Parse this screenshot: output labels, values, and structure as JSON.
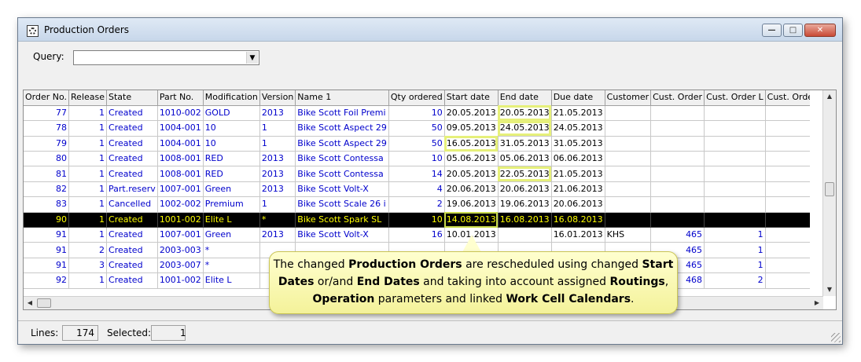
{
  "window": {
    "title": "Production Orders",
    "controls": [
      "minimize-icon",
      "maximize-icon",
      "close-icon"
    ]
  },
  "query": {
    "label": "Query:",
    "value": ""
  },
  "table": {
    "columns": [
      "Order No.",
      "Release",
      "State",
      "Part No.",
      "Modification",
      "Version",
      "Name 1",
      "Qty ordered",
      "Start date",
      "End date",
      "Due date",
      "Customer",
      "Cust. Order",
      "Cust. Order L",
      "Cust. Orde"
    ],
    "rows": [
      [
        "77",
        "1",
        "Created",
        "1010-002",
        "GOLD",
        "2013",
        "Bike Scott Foil Premi",
        "10",
        "20.05.2013",
        "20.05.2013",
        "21.05.2013",
        "",
        "",
        "",
        ""
      ],
      [
        "78",
        "1",
        "Created",
        "1004-001",
        "10",
        "1",
        "Bike Scott Aspect 29",
        "50",
        "09.05.2013",
        "24.05.2013",
        "24.05.2013",
        "",
        "",
        "",
        ""
      ],
      [
        "79",
        "1",
        "Created",
        "1004-001",
        "10",
        "1",
        "Bike Scott Aspect 29",
        "50",
        "16.05.2013",
        "31.05.2013",
        "31.05.2013",
        "",
        "",
        "",
        ""
      ],
      [
        "80",
        "1",
        "Created",
        "1008-001",
        "RED",
        "2013",
        "Bike Scott Contessa",
        "10",
        "05.06.2013",
        "05.06.2013",
        "06.06.2013",
        "",
        "",
        "",
        ""
      ],
      [
        "81",
        "1",
        "Created",
        "1008-001",
        "RED",
        "2013",
        "Bike Scott Contessa",
        "14",
        "20.05.2013",
        "22.05.2013",
        "21.05.2013",
        "",
        "",
        "",
        ""
      ],
      [
        "82",
        "1",
        "Part.reserv",
        "1007-001",
        "Green",
        "2013",
        "Bike Scott Volt-X",
        "4",
        "20.06.2013",
        "20.06.2013",
        "21.06.2013",
        "",
        "",
        "",
        ""
      ],
      [
        "83",
        "1",
        "Cancelled",
        "1002-002",
        "Premium",
        "1",
        "Bike Scott Scale 26 i",
        "2",
        "19.06.2013",
        "19.06.2013",
        "20.06.2013",
        "",
        "",
        "",
        ""
      ],
      [
        "90",
        "1",
        "Created",
        "1001-002",
        "Elite L",
        "*",
        "Bike Scott Spark SL",
        "10",
        "14.08.2013",
        "16.08.2013",
        "16.08.2013",
        "",
        "",
        "",
        ""
      ],
      [
        "91",
        "1",
        "Created",
        "1007-001",
        "Green",
        "2013",
        "Bike Scott Volt-X",
        "16",
        "10.01.2013",
        "",
        "16.01.2013",
        "KHS",
        "465",
        "1",
        ""
      ],
      [
        "91",
        "2",
        "Created",
        "2003-003",
        "*",
        "",
        "",
        "",
        "",
        "",
        "",
        "",
        "465",
        "1",
        ""
      ],
      [
        "91",
        "3",
        "Created",
        "2003-007",
        "*",
        "",
        "",
        "",
        "",
        "",
        "",
        "",
        "465",
        "1",
        ""
      ],
      [
        "92",
        "1",
        "Created",
        "1001-002",
        "Elite L",
        "",
        "",
        "",
        "",
        "",
        "",
        "",
        "468",
        "2",
        ""
      ]
    ],
    "selected_row_index": 7,
    "highlighted_cells": [
      {
        "row": 0,
        "col": 9
      },
      {
        "row": 1,
        "col": 9
      },
      {
        "row": 2,
        "col": 8
      },
      {
        "row": 4,
        "col": 9
      },
      {
        "row": 7,
        "col": 8
      }
    ]
  },
  "status": {
    "lines_label": "Lines:",
    "lines_value": "174",
    "selected_label": "Selected:",
    "selected_value": "1"
  },
  "callout": {
    "segments": [
      {
        "text": "The changed ",
        "bold": false
      },
      {
        "text": "Production Orders",
        "bold": true
      },
      {
        "text": " are rescheduled using changed ",
        "bold": false
      },
      {
        "text": "Start Dates",
        "bold": true
      },
      {
        "text": " or/and ",
        "bold": false
      },
      {
        "text": "End Dates",
        "bold": true
      },
      {
        "text": " and taking into account assigned ",
        "bold": false
      },
      {
        "text": "Routings",
        "bold": true
      },
      {
        "text": ", ",
        "bold": false
      },
      {
        "text": "Operation",
        "bold": true
      },
      {
        "text": " parameters and linked ",
        "bold": false
      },
      {
        "text": "Work Cell Calendars",
        "bold": true
      },
      {
        "text": ".",
        "bold": false
      }
    ]
  }
}
